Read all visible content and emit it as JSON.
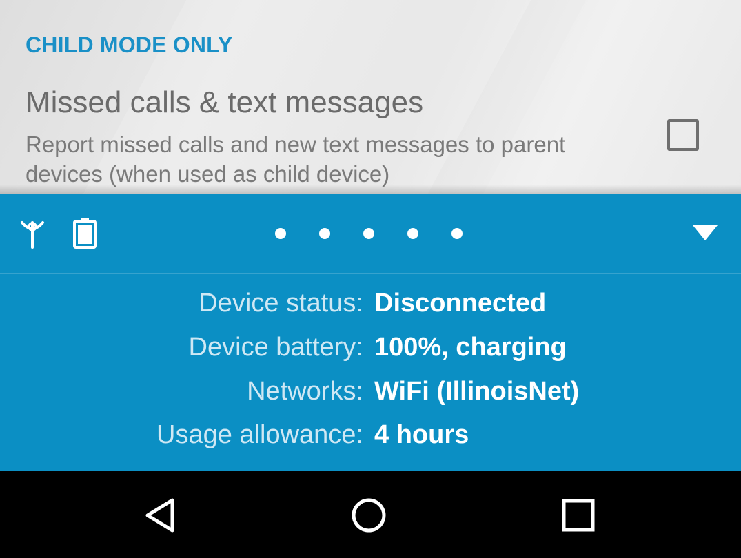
{
  "settings": {
    "section_header": "CHILD MODE ONLY",
    "preference": {
      "title": "Missed calls & text messages",
      "summary": "Report missed calls and new text messages to parent devices (when used as child device)",
      "checked": false
    }
  },
  "status_panel": {
    "background_color": "#0b8fc4",
    "icons": [
      "antenna-icon",
      "battery-icon",
      "collapse-arrow-icon"
    ],
    "page_dots": 5,
    "rows": [
      {
        "label": "Device status:",
        "value": "Disconnected"
      },
      {
        "label": "Device battery:",
        "value": "100%, charging"
      },
      {
        "label": "Networks:",
        "value": "WiFi (IllinoisNet)"
      },
      {
        "label": "Usage allowance:",
        "value": "4 hours"
      }
    ]
  },
  "navbar": {
    "buttons": [
      "back-icon",
      "home-icon",
      "recents-icon"
    ]
  }
}
